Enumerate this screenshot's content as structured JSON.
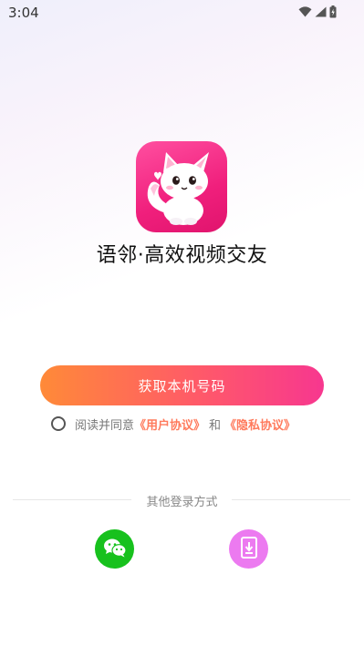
{
  "status_bar": {
    "time": "3:04",
    "icons": [
      "wifi-icon",
      "signal-icon",
      "battery-icon"
    ]
  },
  "app": {
    "logo": "app-logo-cat-icon",
    "title": "语邻·高效视频交友"
  },
  "login": {
    "primary_button_label": "获取本机号码",
    "agreement": {
      "checked": false,
      "prefix": "阅读并同意",
      "user_agreement": "《用户协议》",
      "and": "和",
      "privacy_policy": "《隐私协议》"
    },
    "other_methods_label": "其他登录方式",
    "other_methods": [
      {
        "icon": "wechat-icon",
        "color": "#17c11d"
      },
      {
        "icon": "phone-login-icon",
        "color": "#ec7af0"
      }
    ]
  },
  "colors": {
    "accent_gradient": [
      "#ff8a38",
      "#f7378f"
    ],
    "link": "#ff7a5c"
  }
}
